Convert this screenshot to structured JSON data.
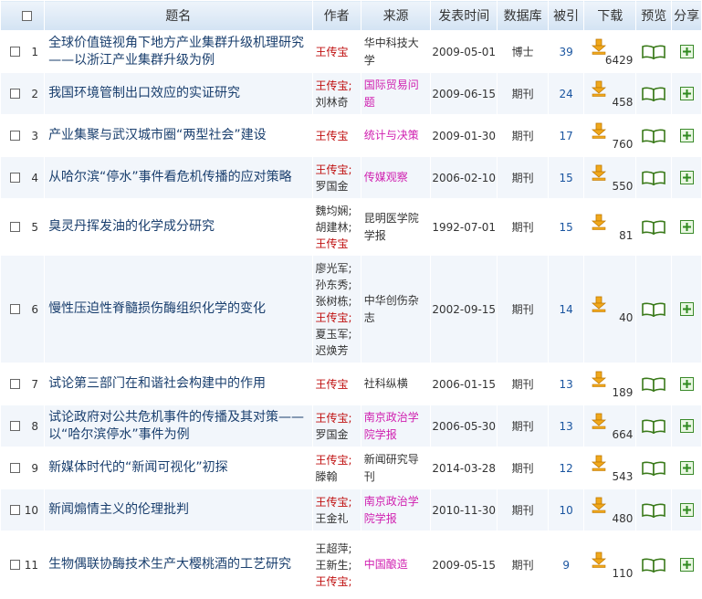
{
  "header": {
    "title": "题名",
    "author": "作者",
    "source": "来源",
    "date": "发表时间",
    "database": "数据库",
    "cited": "被引",
    "download": "下载",
    "preview": "预览",
    "share": "分享"
  },
  "colors": {
    "highlight_author": "#c01010",
    "journal_link": "#d020b0",
    "title_link": "#1a3f6e",
    "count_link": "#1a55a0"
  },
  "rows": [
    {
      "num": "1",
      "title": "全球价值链视角下地方产业集群升级机理研究——以浙江产业集群升级为例",
      "authors": [
        "王传宝"
      ],
      "source": "华中科技大学",
      "date": "2009-05-01",
      "db": "博士",
      "cited": "39",
      "downloads": "6429"
    },
    {
      "num": "2",
      "title": "我国环境管制出口效应的实证研究",
      "authors": [
        "王传宝;",
        "刘林奇"
      ],
      "source": "国际贸易问题",
      "date": "2009-06-15",
      "db": "期刊",
      "cited": "24",
      "downloads": "458"
    },
    {
      "num": "3",
      "title": "产业集聚与武汉城市圈“两型社会”建设",
      "authors": [
        "王传宝"
      ],
      "source": "统计与决策",
      "date": "2009-01-30",
      "db": "期刊",
      "cited": "17",
      "downloads": "760"
    },
    {
      "num": "4",
      "title": "从哈尔滨“停水”事件看危机传播的应对策略",
      "authors": [
        "王传宝;",
        "罗国金"
      ],
      "source": "传媒观察",
      "date": "2006-02-10",
      "db": "期刊",
      "cited": "15",
      "downloads": "550"
    },
    {
      "num": "5",
      "title": "臭灵丹挥发油的化学成分研究",
      "authors": [
        "魏均娴;",
        "胡建林;",
        "王传宝"
      ],
      "source": "昆明医学院学报",
      "date": "1992-07-01",
      "db": "期刊",
      "cited": "15",
      "downloads": "81"
    },
    {
      "num": "6",
      "title": "慢性压迫性脊髓损伤酶组织化学的变化",
      "authors": [
        "廖光军;",
        "孙东秀;",
        "张树栋;",
        "王传宝;",
        "夏玉军;",
        "迟焕芳"
      ],
      "source": "中华创伤杂志",
      "date": "2002-09-15",
      "db": "期刊",
      "cited": "14",
      "downloads": "40"
    },
    {
      "num": "7",
      "title": "试论第三部门在和谐社会构建中的作用",
      "authors": [
        "王传宝"
      ],
      "source": "社科纵横",
      "date": "2006-01-15",
      "db": "期刊",
      "cited": "13",
      "downloads": "189"
    },
    {
      "num": "8",
      "title": "试论政府对公共危机事件的传播及其对策——以“哈尔滨停水”事件为例",
      "authors": [
        "王传宝;",
        "罗国金"
      ],
      "source": "南京政治学院学报",
      "date": "2006-05-30",
      "db": "期刊",
      "cited": "13",
      "downloads": "664"
    },
    {
      "num": "9",
      "title": "新媒体时代的“新闻可视化”初探",
      "authors": [
        "王传宝;",
        "滕翰"
      ],
      "source": "新闻研究导刊",
      "date": "2014-03-28",
      "db": "期刊",
      "cited": "12",
      "downloads": "543"
    },
    {
      "num": "10",
      "title": "新闻煽情主义的伦理批判",
      "authors": [
        "王传宝;",
        "王金礼"
      ],
      "source": "南京政治学院学报",
      "date": "2010-11-30",
      "db": "期刊",
      "cited": "10",
      "downloads": "480"
    },
    {
      "num": "11",
      "title": "生物偶联协酶技术生产大樱桃酒的工艺研究",
      "authors": [
        "王超萍;",
        "王新生;",
        "王传宝;"
      ],
      "source": "中国酿造",
      "date": "2009-05-15",
      "db": "期刊",
      "cited": "9",
      "downloads": "110"
    }
  ]
}
